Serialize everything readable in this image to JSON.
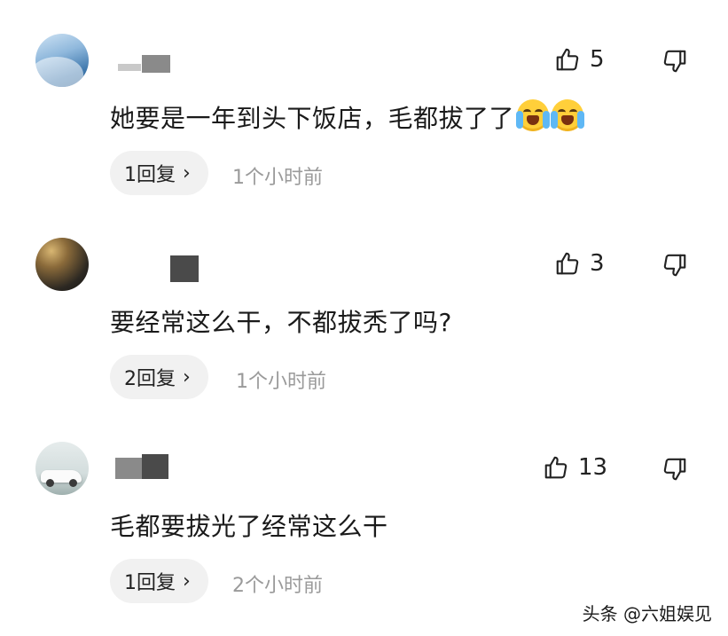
{
  "comments": [
    {
      "avatar": "blue-wave-avatar",
      "text": "她要是一年到头下饭店，毛都拔了了",
      "emojis": [
        "crying-laughing-emoji",
        "crying-laughing-emoji"
      ],
      "likes": "5",
      "reply_label": "1回复",
      "time": "1个小时前"
    },
    {
      "avatar": "dark-photo-avatar",
      "text": "要经常这么干，不都拔秃了吗?",
      "emojis": [],
      "likes": "3",
      "reply_label": "2回复",
      "time": "1个小时前"
    },
    {
      "avatar": "white-car-avatar",
      "text": "毛都要拔光了经常这么干",
      "emojis": [],
      "likes": "13",
      "reply_label": "1回复",
      "time": "2个小时前"
    }
  ],
  "icons": {
    "like": "thumbs-up-icon",
    "dislike": "thumbs-down-icon",
    "reply_arrow": "chevron-right-icon"
  },
  "watermark": "头条 @六姐娱见",
  "colors": {
    "reply_bg": "#f1f1f1",
    "time_text": "#9a9a9a"
  }
}
